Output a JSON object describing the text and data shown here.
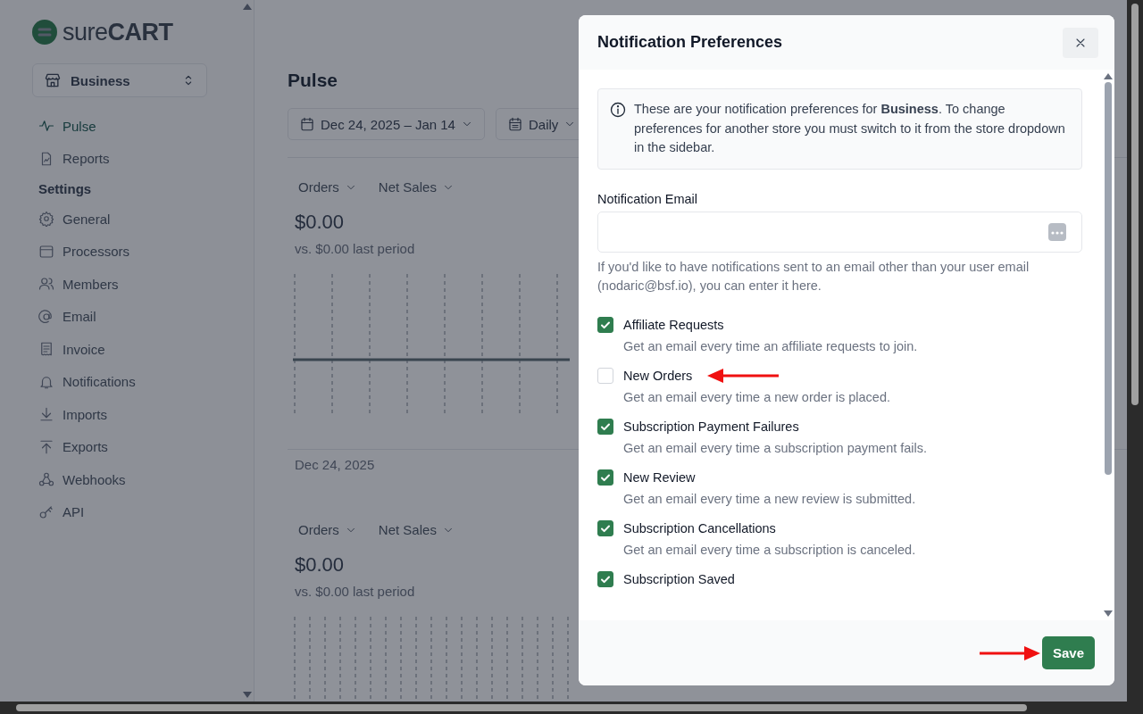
{
  "sidebar": {
    "logo": "sure**CART**",
    "store_switcher": {
      "label": "Business"
    },
    "nav": [
      {
        "label": "Pulse",
        "selected": true
      },
      {
        "label": "Reports",
        "selected": false
      }
    ],
    "settings_heading": "Settings",
    "settings_items": [
      {
        "label": "General"
      },
      {
        "label": "Processors"
      },
      {
        "label": "Members"
      },
      {
        "label": "Email"
      },
      {
        "label": "Invoice"
      },
      {
        "label": "Notifications"
      },
      {
        "label": "Imports"
      },
      {
        "label": "Exports"
      },
      {
        "label": "Webhooks"
      },
      {
        "label": "API"
      }
    ]
  },
  "main": {
    "title": "Pulse",
    "filters": [
      {
        "label": "Dec 24, 2025 – Jan 14"
      },
      {
        "label": "Daily"
      }
    ],
    "cards": [
      {
        "dropdowns": [
          "Orders",
          "Net Sales"
        ],
        "amount": "$0.00",
        "comparison": "vs. $0.00 last period",
        "axis_label": "Dec 24, 2025"
      },
      {
        "dropdowns": [
          "Orders",
          "Net Sales"
        ],
        "amount": "$0.00",
        "comparison": "vs. $0.00 last period"
      }
    ]
  },
  "modal": {
    "title": "Notification Preferences",
    "info": "These are your notification preferences for **Business**. To change preferences for another store you must switch to it from the store dropdown in the sidebar.",
    "email_label": "Notification Email",
    "email_help": "If you'd like to have notifications sent to an email other than your user email (nodaric@bsf.io), you can enter it here.",
    "preferences": [
      {
        "label": "Affiliate Requests",
        "description": "Get an email every time an affiliate requests to join.",
        "checked": true,
        "highlighted": false
      },
      {
        "label": "New Orders",
        "description": "Get an email every time a new order is placed.",
        "checked": false,
        "highlighted": true
      },
      {
        "label": "Subscription Payment Failures",
        "description": "Get an email every time a subscription payment fails.",
        "checked": true,
        "highlighted": false
      },
      {
        "label": "New Review",
        "description": "Get an email every time a new review is submitted.",
        "checked": true,
        "highlighted": false
      },
      {
        "label": "Subscription Cancellations",
        "description": "Get an email every time a subscription is canceled.",
        "checked": true,
        "highlighted": false
      },
      {
        "label": "Subscription Saved",
        "checked": true,
        "highlighted": false
      }
    ],
    "save_button": {
      "label": "Save",
      "highlighted": true
    }
  }
}
